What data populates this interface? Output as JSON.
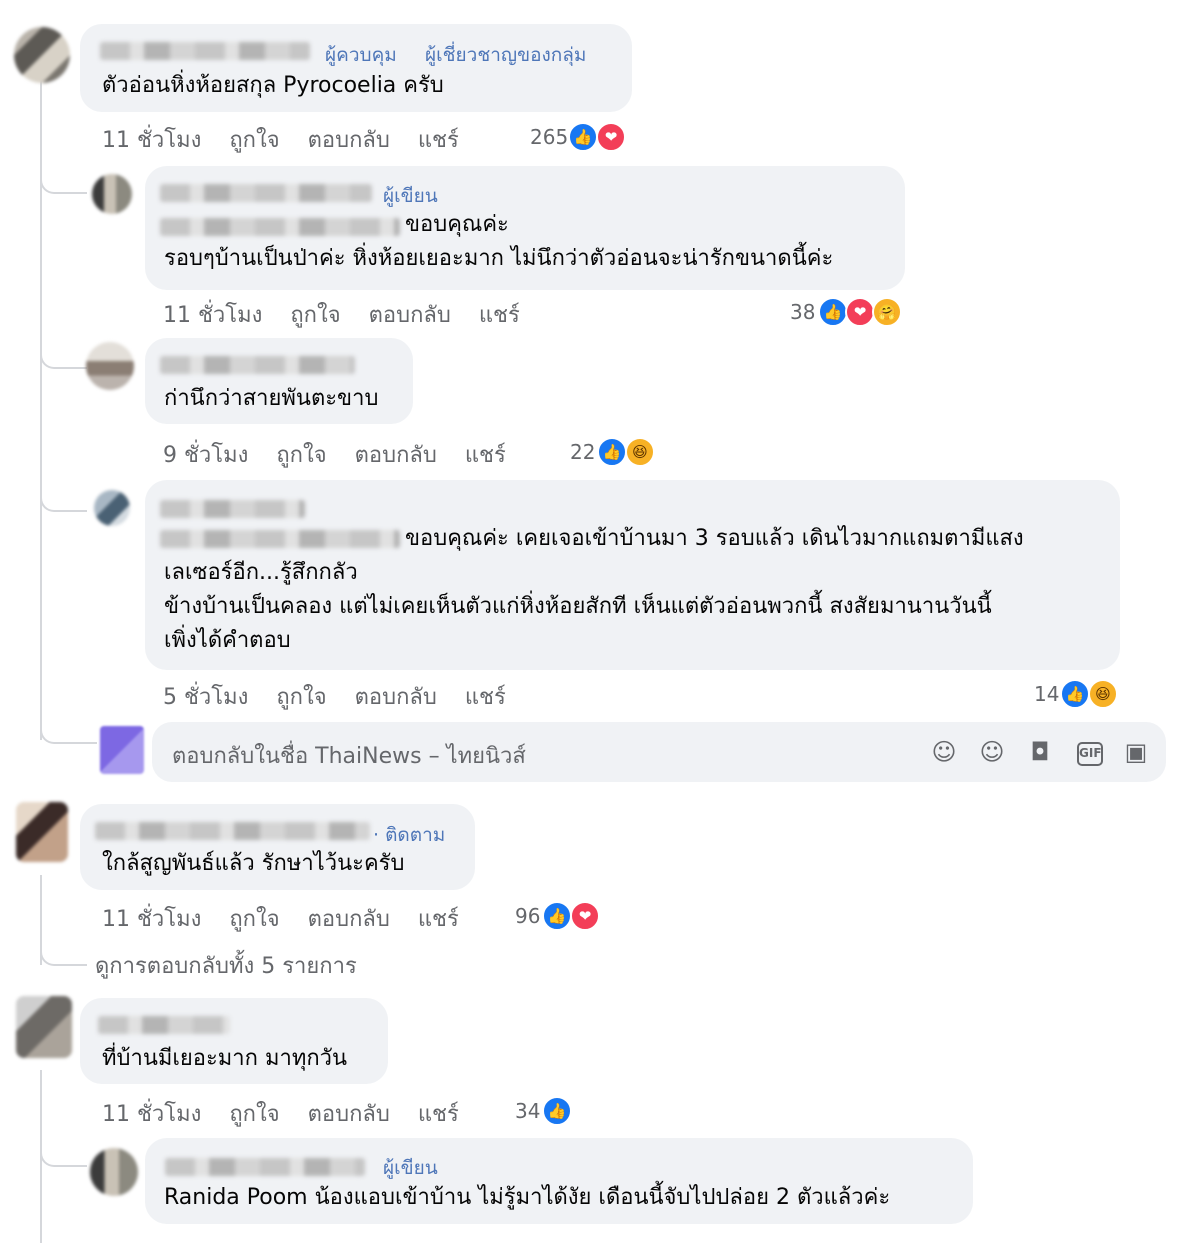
{
  "labels": {
    "like": "ถูกใจ",
    "reply": "ตอบกลับ",
    "share": "แชร์"
  },
  "comments": [
    {
      "badges": [
        "ผู้ควบคุม",
        "ผู้เชี่ยวชาญของกลุ่ม"
      ],
      "lines": [
        "ตัวอ่อนหิ่งห้อยสกุล Pyrocoelia ครับ"
      ],
      "time": "11 ชั่วโมง",
      "count": "265",
      "reactions": [
        "like",
        "love"
      ]
    },
    {
      "badges": [
        "ผู้เขียน"
      ],
      "lines": [
        "ขอบคุณค่ะ",
        "รอบๆบ้านเป็นป่าค่ะ หิ่งห้อยเยอะมาก ไม่นึกว่าตัวอ่อนจะน่ารักขนาดนี้ค่ะ"
      ],
      "time": "11 ชั่วโมง",
      "count": "38",
      "reactions": [
        "like",
        "love",
        "care"
      ]
    },
    {
      "badges": [],
      "lines": [
        "ก่านึกว่าสายพันตะขาบ"
      ],
      "time": "9 ชั่วโมง",
      "count": "22",
      "reactions": [
        "like",
        "haha"
      ]
    },
    {
      "badges": [],
      "lines": [
        "ขอบคุณค่ะ เคยเจอเข้าบ้านมา 3 รอบแล้ว เดินไวมากแถมตามีแสง",
        "เลเซอร์อีก...รู้สึกกลัว",
        "ข้างบ้านเป็นคลอง แต่ไม่เคยเห็นตัวแก่หิ่งห้อยสักที เห็นแต่ตัวอ่อนพวกนี้ สงสัยมานานวันนี้",
        "เพิ่งได้คำตอบ"
      ],
      "time": "5 ชั่วโมง",
      "count": "14",
      "reactions": [
        "like",
        "haha"
      ]
    },
    {
      "badges": [
        "· ติดตาม"
      ],
      "lines": [
        "ใกล้สูญพันธ์แล้ว รักษาไว้นะครับ"
      ],
      "time": "11 ชั่วโมง",
      "count": "96",
      "reactions": [
        "like",
        "love"
      ]
    },
    {
      "badges": [],
      "lines": [
        "ที่บ้านมีเยอะมาก มาทุกวัน"
      ],
      "time": "11 ชั่วโมง",
      "count": "34",
      "reactions": [
        "like"
      ]
    },
    {
      "badges": [
        "ผู้เขียน"
      ],
      "lines": [
        "Ranida Poom น้องแอบเข้าบ้าน ไม่รู้มาได้งัย เดือนนี้จับไปปล่อย 2 ตัวแล้วค่ะ"
      ]
    }
  ],
  "reply_box": {
    "placeholder": "ตอบกลับในชื่อ ThaiNews – ไทยนิวส์",
    "icons": [
      "avatar-sticker-icon",
      "emoji-icon",
      "camera-icon",
      "gif-icon",
      "sticker-icon"
    ]
  },
  "view_replies": "ดูการตอบกลับทั้ง 5 รายการ"
}
